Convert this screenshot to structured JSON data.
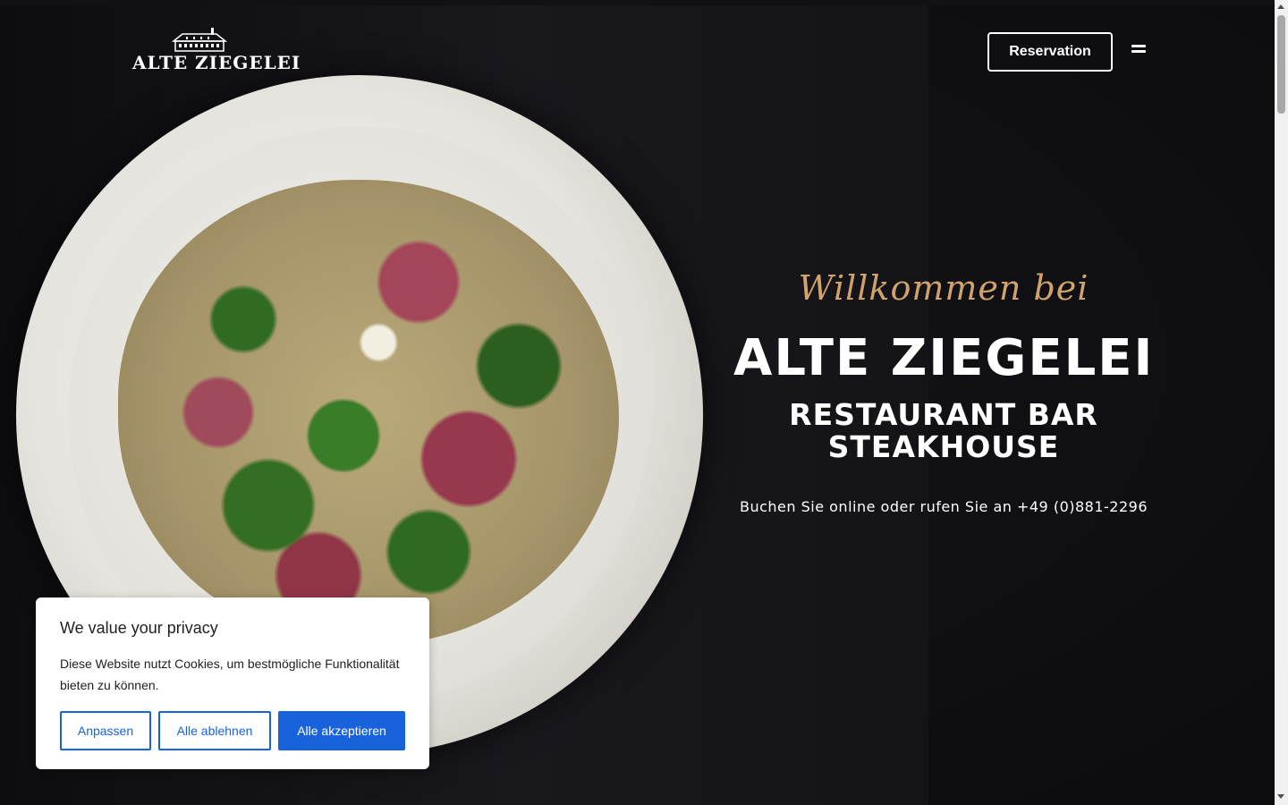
{
  "header": {
    "logo_text": "ALTE  ZIEGELEI",
    "reservation_label": "Reservation",
    "menu_icon": "hamburger-menu-icon"
  },
  "hero": {
    "welcome": "Willkommen bei",
    "title": "ALTE ZIEGELEI",
    "subtitle_line1": "RESTAURANT BAR",
    "subtitle_line2": "STEAKHOUSE",
    "phone_line": "Buchen Sie online oder rufen Sie an +49 (0)881-2296",
    "image": "steak-broccoli-rice-plate"
  },
  "cookie_banner": {
    "title": "We value your privacy",
    "text": "Diese Website nutzt Cookies, um bestmögliche Funktionalität bieten zu können.",
    "customize_label": "Anpassen",
    "reject_label": "Alle ablehnen",
    "accept_label": "Alle akzeptieren"
  },
  "colors": {
    "accent_gold": "#d2a26b",
    "cookie_blue": "#1863dc",
    "background": "#0f0f10"
  }
}
